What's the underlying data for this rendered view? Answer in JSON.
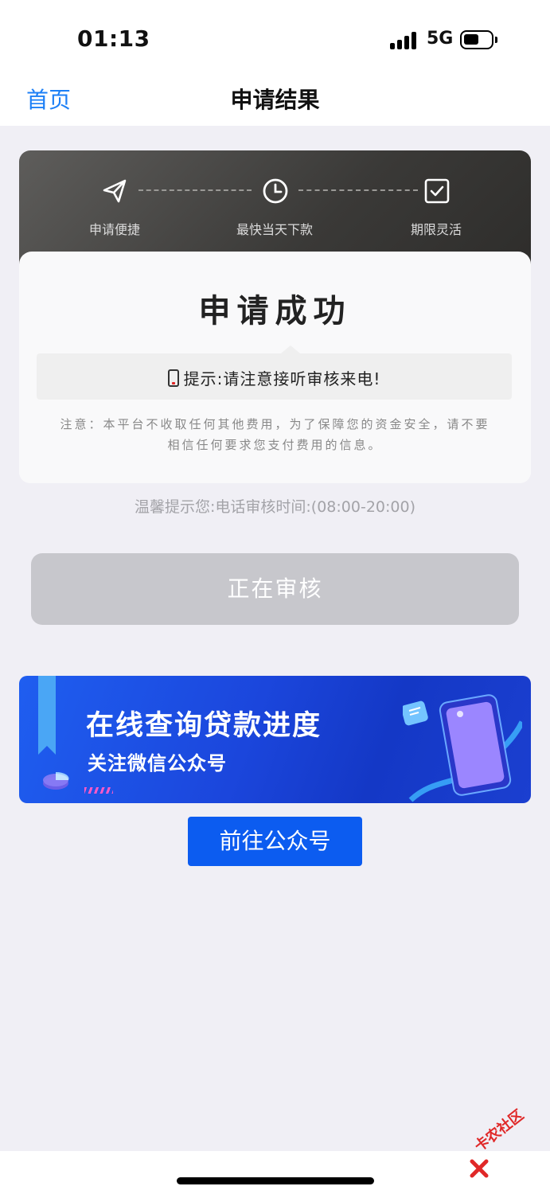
{
  "status_bar": {
    "time": "01:13",
    "network": "5G"
  },
  "nav": {
    "back_label": "首页",
    "title": "申请结果"
  },
  "steps": [
    {
      "icon": "paper-plane-icon",
      "label": "申请便捷"
    },
    {
      "icon": "clock-icon",
      "label": "最快当天下款"
    },
    {
      "icon": "checkbox-icon",
      "label": "期限灵活"
    }
  ],
  "result": {
    "title": "申请成功",
    "tip": "提示:请注意接听审核来电!",
    "notice": "注意：本平台不收取任何其他费用，为了保障您的资金安全，请不要相信任何要求您支付费用的信息。"
  },
  "warm_tip": "温馨提示您:电话审核时间:(08:00-20:00)",
  "review_button": "正在审核",
  "banner": {
    "title": "在线查询贷款进度",
    "subtitle": "关注微信公众号"
  },
  "goto_button": "前往公众号",
  "watermark": "卡农社区",
  "colors": {
    "link_blue": "#1c7ff6",
    "button_blue": "#0c5cf0",
    "disabled_gray": "#c7c7cc",
    "header_dark": "#3a3937",
    "watermark_red": "#e02828"
  }
}
